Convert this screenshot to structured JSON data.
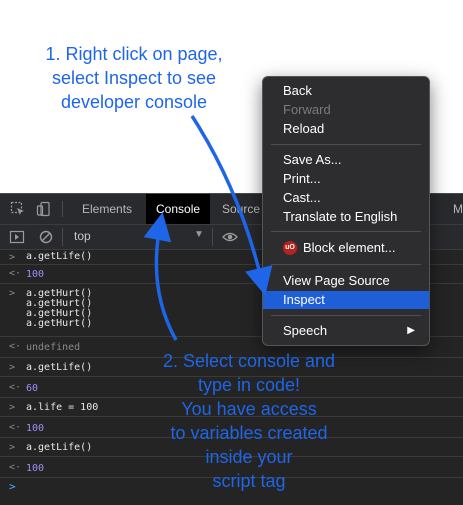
{
  "devtools": {
    "tabs": [
      {
        "label": "Elements",
        "active": false
      },
      {
        "label": "Console",
        "active": true
      },
      {
        "label": "Source",
        "active": false
      },
      {
        "label": "M",
        "active": false
      }
    ],
    "toolbar": {
      "context": "top"
    }
  },
  "console": {
    "entries": [
      {
        "type": "input",
        "lines": [
          "a.getLife()"
        ]
      },
      {
        "type": "result",
        "value": "100"
      },
      {
        "type": "input",
        "lines": [
          "a.getHurt()",
          "a.getHurt()",
          "a.getHurt()",
          "a.getHurt()"
        ]
      },
      {
        "type": "result",
        "value": "undefined"
      },
      {
        "type": "input",
        "lines": [
          "a.getLife()"
        ]
      },
      {
        "type": "result",
        "value": "60"
      },
      {
        "type": "input",
        "lines": [
          "a.life = 100"
        ]
      },
      {
        "type": "result",
        "value": "100"
      },
      {
        "type": "input",
        "lines": [
          "a.getLife()"
        ]
      },
      {
        "type": "result",
        "value": "100"
      }
    ],
    "prompt_symbol": ">"
  },
  "context_menu": {
    "items": {
      "back": "Back",
      "forward": "Forward",
      "reload": "Reload",
      "save_as": "Save As...",
      "print": "Print...",
      "cast": "Cast...",
      "translate": "Translate to English",
      "block_element": "Block element...",
      "view_source": "View Page Source",
      "inspect": "Inspect",
      "speech": "Speech"
    },
    "ublock_badge": "uO",
    "highlight_color": "#1e5fd8"
  },
  "annotations": {
    "note1": [
      "1. Right click on page,",
      "select Inspect to see",
      "developer console"
    ],
    "note2": [
      "2. Select console and",
      "type in code!",
      "You have access",
      "to variables created",
      "inside your",
      "script tag"
    ],
    "color": "#1f65e8"
  }
}
